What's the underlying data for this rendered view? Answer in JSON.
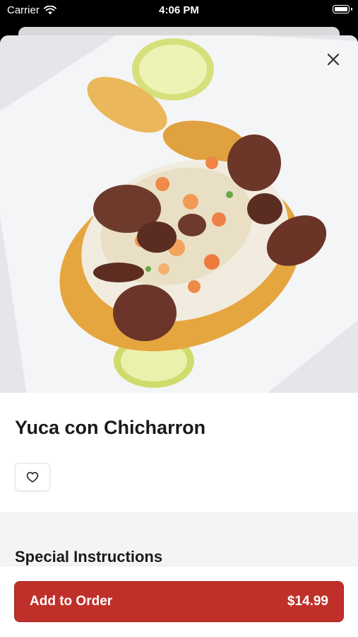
{
  "status_bar": {
    "carrier": "Carrier",
    "time": "4:06 PM"
  },
  "item": {
    "title": "Yuca con Chicharron"
  },
  "instructions": {
    "title": "Special Instructions"
  },
  "order_button": {
    "label": "Add to Order",
    "price": "$14.99"
  },
  "colors": {
    "accent": "#c0302a"
  },
  "icons": {
    "close": "close-icon",
    "favorite": "heart-icon",
    "wifi": "wifi-icon"
  }
}
